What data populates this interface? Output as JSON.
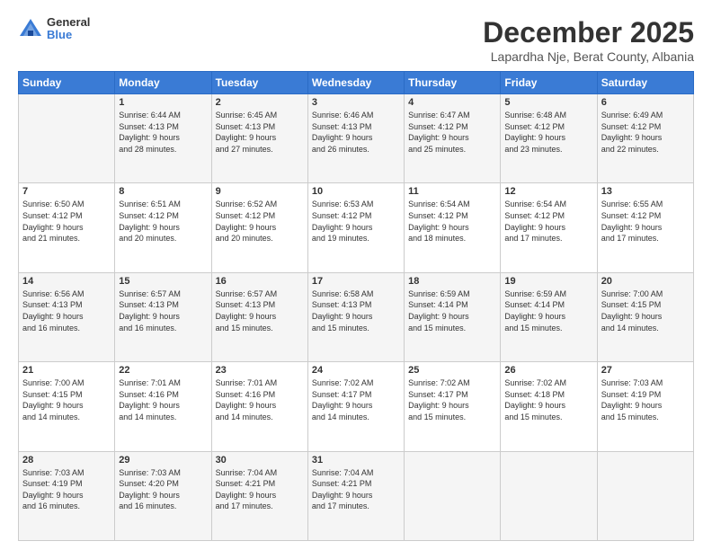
{
  "logo": {
    "general": "General",
    "blue": "Blue"
  },
  "header": {
    "month": "December 2025",
    "location": "Lapardha Nje, Berat County, Albania"
  },
  "weekdays": [
    "Sunday",
    "Monday",
    "Tuesday",
    "Wednesday",
    "Thursday",
    "Friday",
    "Saturday"
  ],
  "weeks": [
    [
      {
        "day": "",
        "info": ""
      },
      {
        "day": "1",
        "info": "Sunrise: 6:44 AM\nSunset: 4:13 PM\nDaylight: 9 hours\nand 28 minutes."
      },
      {
        "day": "2",
        "info": "Sunrise: 6:45 AM\nSunset: 4:13 PM\nDaylight: 9 hours\nand 27 minutes."
      },
      {
        "day": "3",
        "info": "Sunrise: 6:46 AM\nSunset: 4:13 PM\nDaylight: 9 hours\nand 26 minutes."
      },
      {
        "day": "4",
        "info": "Sunrise: 6:47 AM\nSunset: 4:12 PM\nDaylight: 9 hours\nand 25 minutes."
      },
      {
        "day": "5",
        "info": "Sunrise: 6:48 AM\nSunset: 4:12 PM\nDaylight: 9 hours\nand 23 minutes."
      },
      {
        "day": "6",
        "info": "Sunrise: 6:49 AM\nSunset: 4:12 PM\nDaylight: 9 hours\nand 22 minutes."
      }
    ],
    [
      {
        "day": "7",
        "info": "Sunrise: 6:50 AM\nSunset: 4:12 PM\nDaylight: 9 hours\nand 21 minutes."
      },
      {
        "day": "8",
        "info": "Sunrise: 6:51 AM\nSunset: 4:12 PM\nDaylight: 9 hours\nand 20 minutes."
      },
      {
        "day": "9",
        "info": "Sunrise: 6:52 AM\nSunset: 4:12 PM\nDaylight: 9 hours\nand 20 minutes."
      },
      {
        "day": "10",
        "info": "Sunrise: 6:53 AM\nSunset: 4:12 PM\nDaylight: 9 hours\nand 19 minutes."
      },
      {
        "day": "11",
        "info": "Sunrise: 6:54 AM\nSunset: 4:12 PM\nDaylight: 9 hours\nand 18 minutes."
      },
      {
        "day": "12",
        "info": "Sunrise: 6:54 AM\nSunset: 4:12 PM\nDaylight: 9 hours\nand 17 minutes."
      },
      {
        "day": "13",
        "info": "Sunrise: 6:55 AM\nSunset: 4:12 PM\nDaylight: 9 hours\nand 17 minutes."
      }
    ],
    [
      {
        "day": "14",
        "info": "Sunrise: 6:56 AM\nSunset: 4:13 PM\nDaylight: 9 hours\nand 16 minutes."
      },
      {
        "day": "15",
        "info": "Sunrise: 6:57 AM\nSunset: 4:13 PM\nDaylight: 9 hours\nand 16 minutes."
      },
      {
        "day": "16",
        "info": "Sunrise: 6:57 AM\nSunset: 4:13 PM\nDaylight: 9 hours\nand 15 minutes."
      },
      {
        "day": "17",
        "info": "Sunrise: 6:58 AM\nSunset: 4:13 PM\nDaylight: 9 hours\nand 15 minutes."
      },
      {
        "day": "18",
        "info": "Sunrise: 6:59 AM\nSunset: 4:14 PM\nDaylight: 9 hours\nand 15 minutes."
      },
      {
        "day": "19",
        "info": "Sunrise: 6:59 AM\nSunset: 4:14 PM\nDaylight: 9 hours\nand 15 minutes."
      },
      {
        "day": "20",
        "info": "Sunrise: 7:00 AM\nSunset: 4:15 PM\nDaylight: 9 hours\nand 14 minutes."
      }
    ],
    [
      {
        "day": "21",
        "info": "Sunrise: 7:00 AM\nSunset: 4:15 PM\nDaylight: 9 hours\nand 14 minutes."
      },
      {
        "day": "22",
        "info": "Sunrise: 7:01 AM\nSunset: 4:16 PM\nDaylight: 9 hours\nand 14 minutes."
      },
      {
        "day": "23",
        "info": "Sunrise: 7:01 AM\nSunset: 4:16 PM\nDaylight: 9 hours\nand 14 minutes."
      },
      {
        "day": "24",
        "info": "Sunrise: 7:02 AM\nSunset: 4:17 PM\nDaylight: 9 hours\nand 14 minutes."
      },
      {
        "day": "25",
        "info": "Sunrise: 7:02 AM\nSunset: 4:17 PM\nDaylight: 9 hours\nand 15 minutes."
      },
      {
        "day": "26",
        "info": "Sunrise: 7:02 AM\nSunset: 4:18 PM\nDaylight: 9 hours\nand 15 minutes."
      },
      {
        "day": "27",
        "info": "Sunrise: 7:03 AM\nSunset: 4:19 PM\nDaylight: 9 hours\nand 15 minutes."
      }
    ],
    [
      {
        "day": "28",
        "info": "Sunrise: 7:03 AM\nSunset: 4:19 PM\nDaylight: 9 hours\nand 16 minutes."
      },
      {
        "day": "29",
        "info": "Sunrise: 7:03 AM\nSunset: 4:20 PM\nDaylight: 9 hours\nand 16 minutes."
      },
      {
        "day": "30",
        "info": "Sunrise: 7:04 AM\nSunset: 4:21 PM\nDaylight: 9 hours\nand 17 minutes."
      },
      {
        "day": "31",
        "info": "Sunrise: 7:04 AM\nSunset: 4:21 PM\nDaylight: 9 hours\nand 17 minutes."
      },
      {
        "day": "",
        "info": ""
      },
      {
        "day": "",
        "info": ""
      },
      {
        "day": "",
        "info": ""
      }
    ]
  ]
}
